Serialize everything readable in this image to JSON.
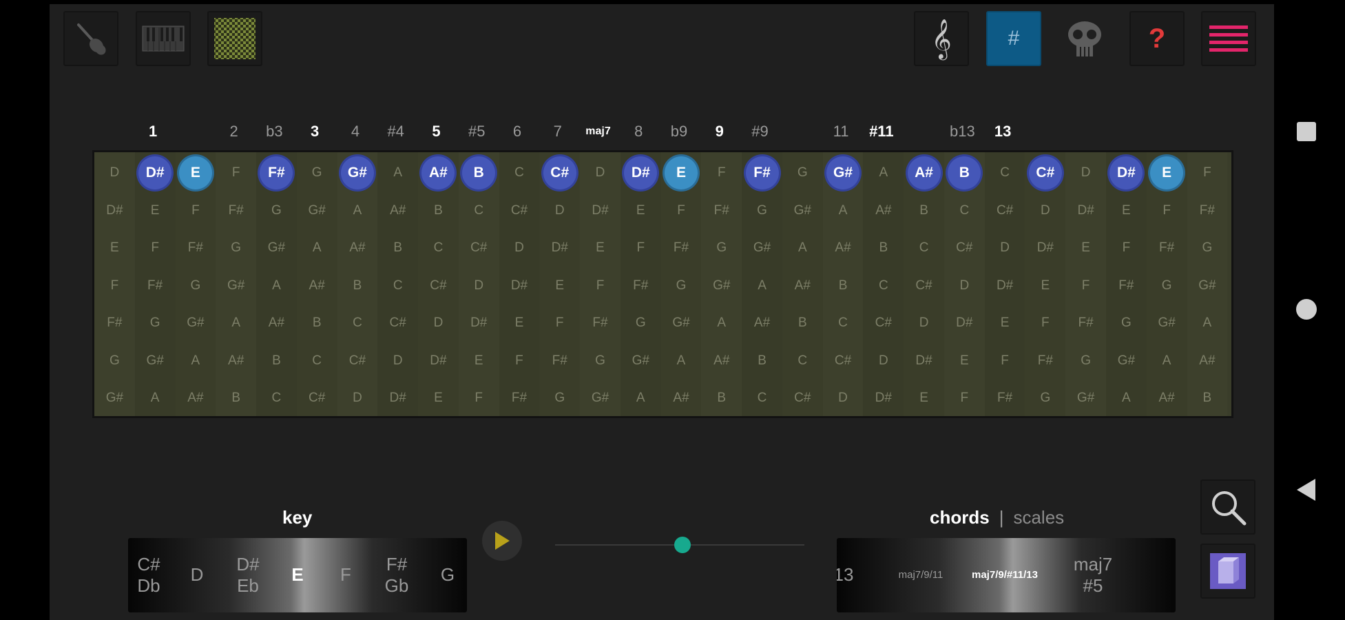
{
  "toolbar": {
    "left": [
      {
        "name": "guitar-icon"
      },
      {
        "name": "piano-icon"
      },
      {
        "name": "grid-icon"
      }
    ],
    "right": [
      {
        "name": "treble-clef-icon"
      },
      {
        "name": "sharp-toggle-button",
        "label": "#",
        "active": true
      },
      {
        "name": "skull-icon"
      },
      {
        "name": "help-button",
        "label": "?"
      },
      {
        "name": "menu-icon"
      }
    ]
  },
  "degrees": [
    "",
    "1",
    "",
    "2",
    "b3",
    "3",
    "4",
    "#4",
    "5",
    "#5",
    "6",
    "7",
    "maj7",
    "8",
    "b9",
    "9",
    "#9",
    "",
    "11",
    "#11",
    "",
    "b13",
    "13",
    "",
    "",
    "",
    ""
  ],
  "highlighted_degrees": [
    "1",
    "3",
    "5",
    "maj7",
    "9",
    "#11",
    "13"
  ],
  "fretboard": {
    "rows": [
      [
        "D",
        "D#",
        "E",
        "F",
        "F#",
        "G",
        "G#",
        "A",
        "A#",
        "B",
        "C",
        "C#",
        "D",
        "D#",
        "E",
        "F",
        "F#",
        "G",
        "G#",
        "A",
        "A#",
        "B",
        "C",
        "C#",
        "D",
        "D#",
        "E",
        "F"
      ],
      [
        "D#",
        "E",
        "F",
        "F#",
        "G",
        "G#",
        "A",
        "A#",
        "B",
        "C",
        "C#",
        "D",
        "D#",
        "E",
        "F",
        "F#",
        "G",
        "G#",
        "A",
        "A#",
        "B",
        "C",
        "C#",
        "D",
        "D#",
        "E",
        "F",
        "F#"
      ],
      [
        "E",
        "F",
        "F#",
        "G",
        "G#",
        "A",
        "A#",
        "B",
        "C",
        "C#",
        "D",
        "D#",
        "E",
        "F",
        "F#",
        "G",
        "G#",
        "A",
        "A#",
        "B",
        "C",
        "C#",
        "D",
        "D#",
        "E",
        "F",
        "F#",
        "G"
      ],
      [
        "F",
        "F#",
        "G",
        "G#",
        "A",
        "A#",
        "B",
        "C",
        "C#",
        "D",
        "D#",
        "E",
        "F",
        "F#",
        "G",
        "G#",
        "A",
        "A#",
        "B",
        "C",
        "C#",
        "D",
        "D#",
        "E",
        "F",
        "F#",
        "G",
        "G#"
      ],
      [
        "F#",
        "G",
        "G#",
        "A",
        "A#",
        "B",
        "C",
        "C#",
        "D",
        "D#",
        "E",
        "F",
        "F#",
        "G",
        "G#",
        "A",
        "A#",
        "B",
        "C",
        "C#",
        "D",
        "D#",
        "E",
        "F",
        "F#",
        "G",
        "G#",
        "A"
      ],
      [
        "G",
        "G#",
        "A",
        "A#",
        "B",
        "C",
        "C#",
        "D",
        "D#",
        "E",
        "F",
        "F#",
        "G",
        "G#",
        "A",
        "A#",
        "B",
        "C",
        "C#",
        "D",
        "D#",
        "E",
        "F",
        "F#",
        "G",
        "G#",
        "A",
        "A#"
      ],
      [
        "G#",
        "A",
        "A#",
        "B",
        "C",
        "C#",
        "D",
        "D#",
        "E",
        "F",
        "F#",
        "G",
        "G#",
        "A",
        "A#",
        "B",
        "C",
        "C#",
        "D",
        "D#",
        "E",
        "F",
        "F#",
        "G",
        "G#",
        "A",
        "A#",
        "B"
      ]
    ],
    "root_note": "E",
    "chord_notes": [
      "G#",
      "B",
      "D#",
      "F#",
      "A#",
      "C#"
    ],
    "highlight_row": 0
  },
  "key_panel": {
    "label": "key",
    "items": [
      {
        "top": "C#",
        "bottom": "Db"
      },
      {
        "top": "D",
        "bottom": ""
      },
      {
        "top": "D#",
        "bottom": "Eb"
      },
      {
        "top": "E",
        "bottom": "",
        "selected": true
      },
      {
        "top": "F",
        "bottom": ""
      },
      {
        "top": "F#",
        "bottom": "Gb"
      },
      {
        "top": "G",
        "bottom": ""
      }
    ]
  },
  "controls": {
    "play_icon": "play-icon",
    "slider_value": 0.5
  },
  "chord_panel": {
    "tab_chords": "chords",
    "separator": "|",
    "tab_scales": "scales",
    "items": [
      {
        "top": "13",
        "bottom": ""
      },
      {
        "top": "maj7/9/11",
        "bottom": ""
      },
      {
        "top": "maj7/9/#11/13",
        "bottom": "",
        "selected": true
      },
      {
        "top": "maj7",
        "bottom": "#5"
      }
    ]
  },
  "side_buttons": [
    {
      "name": "search-icon"
    },
    {
      "name": "book-icon"
    }
  ],
  "android_nav": [
    {
      "name": "recents-icon"
    },
    {
      "name": "home-icon"
    },
    {
      "name": "back-icon"
    }
  ],
  "colors": {
    "background": "#1f1f1f",
    "fretboard": "#3a3d2a",
    "root": "#3b8fc4",
    "chord": "#4557b8",
    "accent": "#0d5a86",
    "menu": "#e3256b",
    "help": "#e23a3a",
    "slider_thumb": "#17a98e",
    "play": "#b8a11a"
  }
}
